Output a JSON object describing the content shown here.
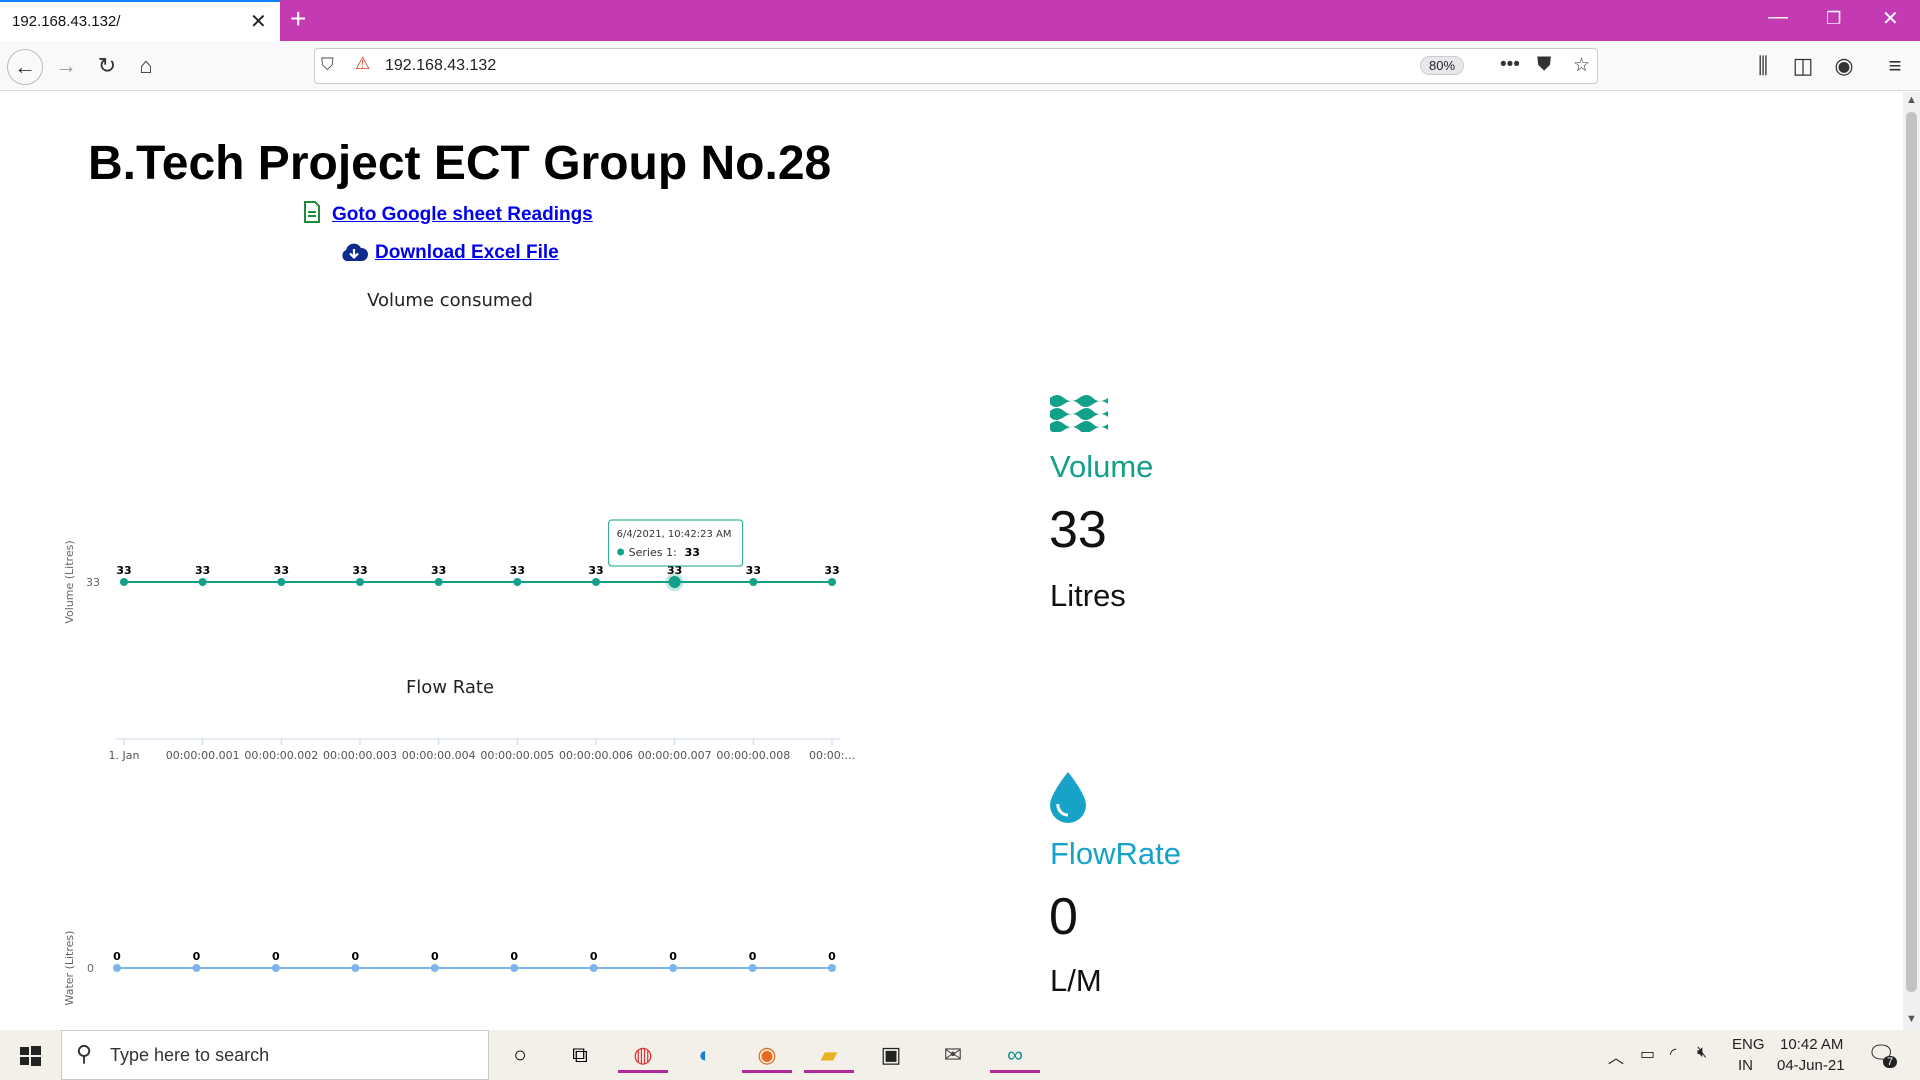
{
  "browser": {
    "tab_title": "192.168.43.132/",
    "url": "192.168.43.132",
    "zoom": "80%"
  },
  "page": {
    "title": "B.Tech Project ECT Group No.28",
    "link_sheet": "Goto Google sheet Readings",
    "link_download": "Download Excel File"
  },
  "cards": {
    "volume": {
      "label": "Volume",
      "value": "33",
      "unit": "Litres"
    },
    "flowrate": {
      "label": "FlowRate",
      "value": "0",
      "unit": "L/M"
    }
  },
  "chart_data": [
    {
      "type": "line",
      "title": "Volume consumed",
      "ylabel": "Volume (Litres)",
      "xlabel": "",
      "color": "#13a089",
      "x": [
        "1. Jan",
        "00:00:00.001",
        "00:00:00.002",
        "00:00:00.003",
        "00:00:00.004",
        "00:00:00.005",
        "00:00:00.006",
        "00:00:00.007",
        "00:00:00.008",
        "00:00:..."
      ],
      "yticks": [
        "33"
      ],
      "series": [
        {
          "name": "Series 1",
          "values": [
            33,
            33,
            33,
            33,
            33,
            33,
            33,
            33,
            33,
            33
          ]
        }
      ],
      "tooltip": {
        "point_index": 7,
        "date": "6/4/2021, 10:42:23 AM",
        "series": "Series 1:",
        "value": "33"
      }
    },
    {
      "type": "line",
      "title": "Flow Rate",
      "ylabel": "Water (Litres)",
      "xlabel": "",
      "color": "#7cb5ec",
      "x": [],
      "yticks": [
        "0"
      ],
      "series": [
        {
          "values": [
            0,
            0,
            0,
            0,
            0,
            0,
            0,
            0,
            0,
            0
          ]
        }
      ]
    }
  ],
  "taskbar": {
    "search_placeholder": "Type here to search",
    "lang_line1": "ENG",
    "lang_line2": "IN",
    "time": "10:42 AM",
    "date": "04-Jun-21",
    "notification_count": "7"
  }
}
